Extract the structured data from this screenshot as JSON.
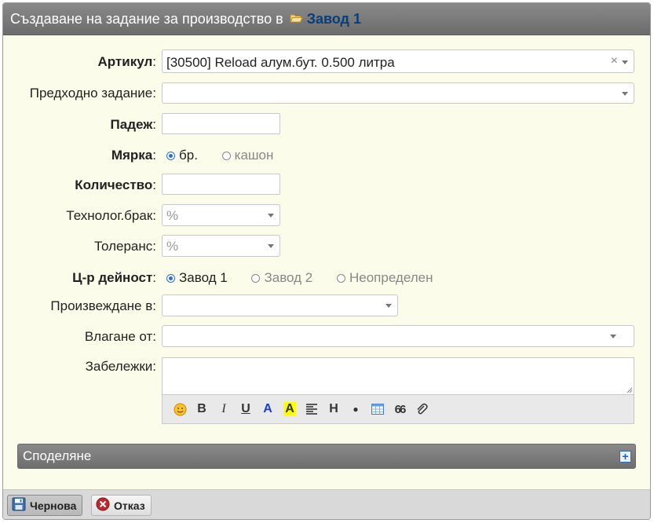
{
  "title": {
    "text": "Създаване на задание за производство в",
    "plant": "Завод 1"
  },
  "fields": {
    "article": {
      "label": "Артикул",
      "value": "[30500] Reload алум.бут. 0.500 литра"
    },
    "previous_task": {
      "label": "Предходно задание",
      "value": ""
    },
    "due": {
      "label": "Падеж",
      "value": ""
    },
    "measure": {
      "label": "Мярка",
      "options": [
        "бр.",
        "кашон"
      ],
      "selected": "бр."
    },
    "quantity": {
      "label": "Количество",
      "value": ""
    },
    "tech_waste": {
      "label": "Технолог.брак",
      "placeholder": "%"
    },
    "tolerance": {
      "label": "Толеранс",
      "placeholder": "%"
    },
    "activity_center": {
      "label": "Ц-р дейност",
      "options": [
        "Завод 1",
        "Завод 2",
        "Неопределен"
      ],
      "selected": "Завод 1"
    },
    "produce_in": {
      "label": "Произвеждане в",
      "value": ""
    },
    "input_from": {
      "label": "Влагане от",
      "value": ""
    },
    "notes": {
      "label": "Забележки",
      "value": ""
    }
  },
  "toolbar_icons": [
    "emoji-icon",
    "bold-icon",
    "italic-icon",
    "underline-icon",
    "font-color-icon",
    "highlight-icon",
    "align-icon",
    "heading-icon",
    "bullet-icon",
    "table-icon",
    "quote-icon",
    "attach-icon"
  ],
  "toolbar_glyphs": {
    "bold": "B",
    "italic": "I",
    "underline": "U",
    "color": "A",
    "highlight": "A",
    "heading": "H",
    "bullet": "●",
    "quote": "66"
  },
  "share": {
    "label": "Споделяне"
  },
  "buttons": {
    "draft": "Чернова",
    "cancel": "Отказ"
  },
  "colors": {
    "titlebar": "#7a7a7a",
    "plant_link": "#0a3d7a",
    "form_bg": "#fcfcea",
    "radio_selected": "#2a6fd6"
  }
}
